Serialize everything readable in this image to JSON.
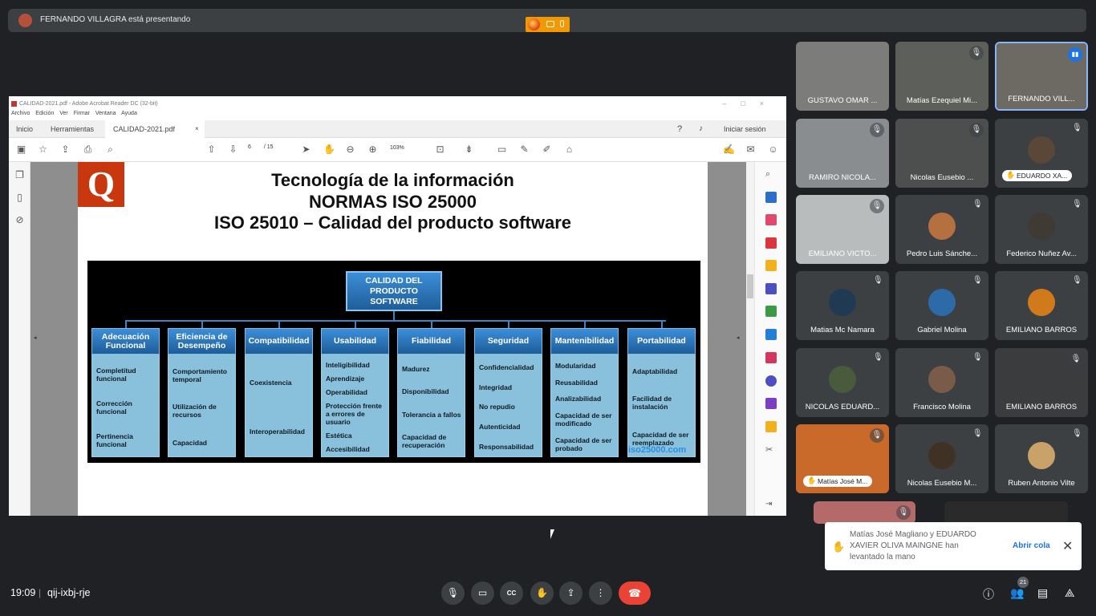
{
  "presenting_banner": {
    "text": "FERNANDO VILLAGRA está presentando"
  },
  "acrobat": {
    "window_title": "CALIDAD-2021.pdf - Adobe Acrobat Reader DC (32-bit)",
    "menu": [
      "Archivo",
      "Edición",
      "Ver",
      "Firmar",
      "Ventana",
      "Ayuda"
    ],
    "tabs": {
      "home": "Inicio",
      "tools": "Herramientas",
      "doc": "CALIDAD-2021.pdf",
      "signin": "Iniciar sesión"
    },
    "page_current": "6",
    "page_total": "/ 15",
    "zoom": "103%"
  },
  "slide": {
    "logo": "Q",
    "title_line1": "Tecnología de la información",
    "title_line2": "NORMAS ISO 25000",
    "title_line3": "ISO 25010 – Calidad del producto software",
    "root": [
      "CALIDAD DEL",
      "PRODUCTO",
      "SOFTWARE"
    ],
    "columns": [
      {
        "head": "Adecuación Funcional",
        "items": [
          "Completitud funcional",
          "Corrección funcional",
          "Pertinencia funcional"
        ]
      },
      {
        "head": "Eficiencia de Desempeño",
        "items": [
          "Comportamiento temporal",
          "Utilización de recursos",
          "Capacidad"
        ]
      },
      {
        "head": "Compatibilidad",
        "items": [
          "Coexistencia",
          "Interoperabilidad"
        ]
      },
      {
        "head": "Usabilidad",
        "items": [
          "Inteligibilidad",
          "Aprendizaje",
          "Operabilidad",
          "Protección frente a errores de usuario",
          "Estética",
          "Accesibilidad"
        ]
      },
      {
        "head": "Fiabilidad",
        "items": [
          "Madurez",
          "Disponibilidad",
          "Tolerancia a fallos",
          "Capacidad de recuperación"
        ]
      },
      {
        "head": "Seguridad",
        "items": [
          "Confidencialidad",
          "Integridad",
          "No repudio",
          "Autenticidad",
          "Responsabilidad"
        ]
      },
      {
        "head": "Mantenibilidad",
        "items": [
          "Modularidad",
          "Reusabilidad",
          "Analizabilidad",
          "Capacidad de ser modificado",
          "Capacidad de ser probado"
        ]
      },
      {
        "head": "Portabilidad",
        "items": [
          "Adaptabilidad",
          "Facilidad de instalación",
          "Capacidad de ser reemplazado"
        ]
      }
    ],
    "watermark": "iso25000.com"
  },
  "participants": [
    {
      "name": "GUSTAVO OMAR ...",
      "muted": false,
      "video": true
    },
    {
      "name": "Matías Ezequiel Mi...",
      "muted": true,
      "video": true
    },
    {
      "name": "FERNANDO VILL...",
      "muted": false,
      "video": true,
      "speaking": true
    },
    {
      "name": "RAMIRO NICOLA...",
      "muted": true,
      "video": true
    },
    {
      "name": "Nicolas Eusebio ...",
      "muted": true,
      "video": true
    },
    {
      "name": "EDUARDO XA...",
      "muted": true,
      "video": false,
      "hand_raised": true
    },
    {
      "name": "EMILIANO VICTO...",
      "muted": true,
      "video": true
    },
    {
      "name": "Pedro Luis Sánche...",
      "muted": true,
      "video": false
    },
    {
      "name": "Federico Nuñez Av...",
      "muted": true,
      "video": false
    },
    {
      "name": "Matias Mc Namara",
      "muted": true,
      "video": false
    },
    {
      "name": "Gabriel Molina",
      "muted": true,
      "video": false
    },
    {
      "name": "EMILIANO BARROS",
      "muted": true,
      "video": false
    },
    {
      "name": "NICOLAS EDUARD...",
      "muted": true,
      "video": false
    },
    {
      "name": "Francisco Molina",
      "muted": true,
      "video": false
    },
    {
      "name": "EMILIANO BARROS",
      "muted": true,
      "video": true
    },
    {
      "name": "Matías José M...",
      "muted": true,
      "video": true,
      "hand_raised": true
    },
    {
      "name": "Nicolas Eusebio M...",
      "muted": true,
      "video": false
    },
    {
      "name": "Ruben Antonio Vilte",
      "muted": true,
      "video": false
    }
  ],
  "toast": {
    "message": "Matías José Magliano y EDUARDO XAVIER OLIVA MAINGNE han levantado la mano",
    "action": "Abrir cola"
  },
  "bottom": {
    "time": "19:09",
    "separator": "|",
    "meeting_code": "qij-ixbj-rje",
    "people_count": "21"
  },
  "colors": {
    "background": "#202124",
    "leave": "#ea4335",
    "accent": "#1a73e8",
    "logo": "#c8370e"
  }
}
